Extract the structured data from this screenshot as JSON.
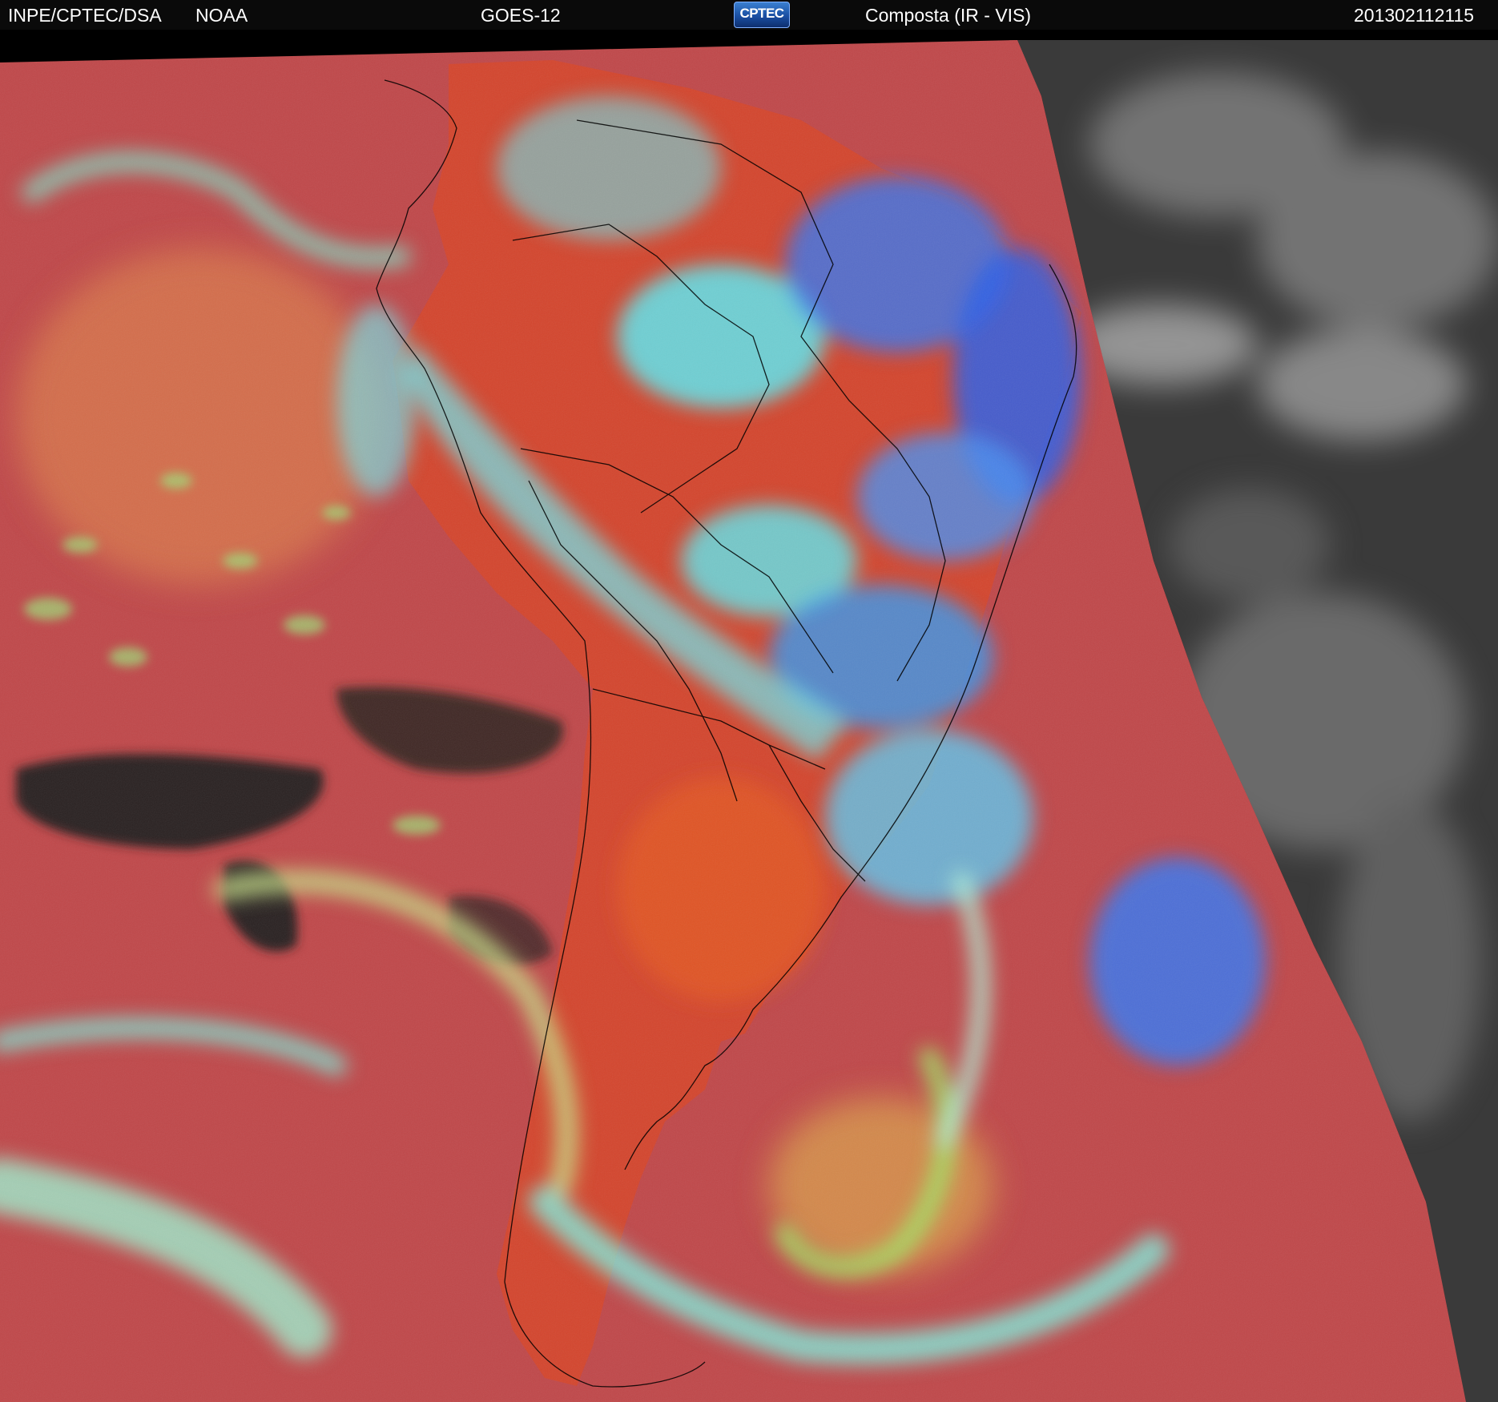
{
  "header": {
    "institution": "INPE/CPTEC/DSA",
    "agency": "NOAA",
    "satellite": "GOES-12",
    "logo_text": "CPTEC",
    "product": "Composta (IR - VIS)",
    "timestamp": "201302112115"
  },
  "colors": {
    "clear_ocean": "#c0484a",
    "clear_land": "#e0502c",
    "low_cloud_green": "#9ee07a",
    "high_cloud_cyan": "#5ee8f0",
    "deep_convection_blue": "#3a78f0",
    "night_gray": "#3a3a3a",
    "header_bg": "#0a0a0a",
    "coastline": "#000000"
  },
  "map": {
    "region": "South America",
    "icon": "satellite-image"
  }
}
